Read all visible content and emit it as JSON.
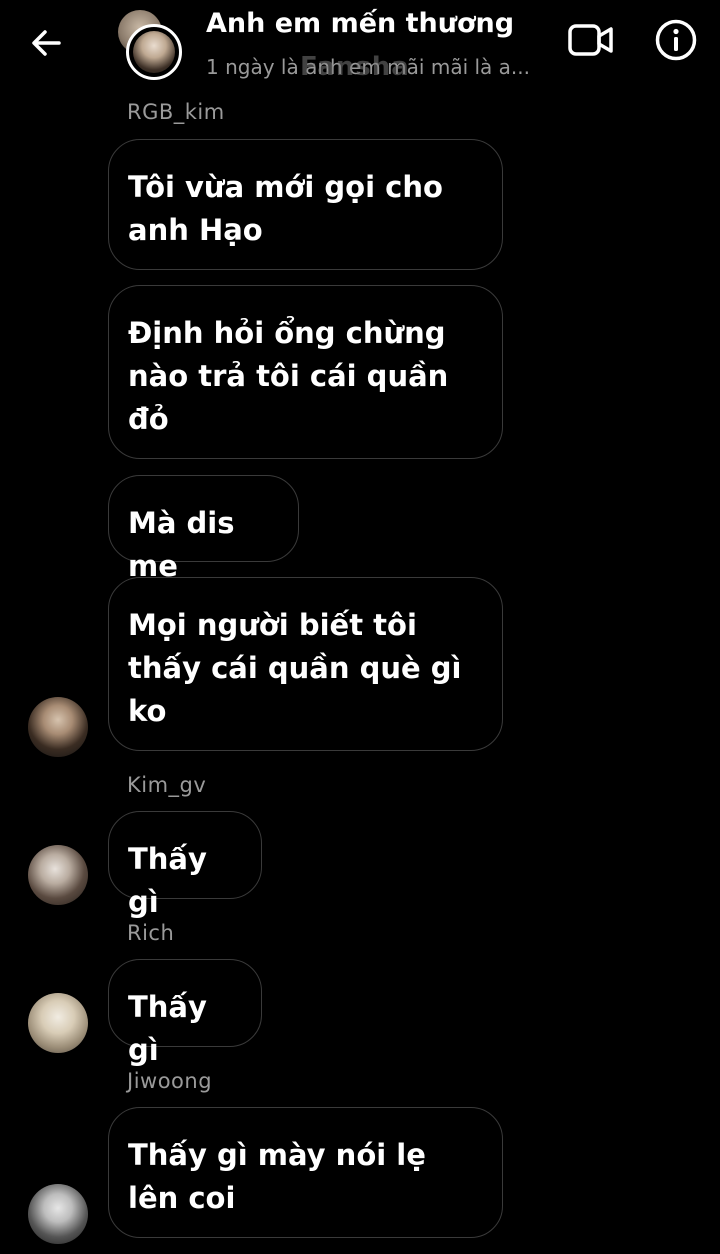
{
  "header": {
    "title": "Anh em mến thương",
    "subtitle": "1 ngày là anh em mãi mãi là a...",
    "watermark": "Fansha",
    "icons": {
      "back": "back-arrow-icon",
      "video": "video-call-icon",
      "info": "info-icon"
    }
  },
  "messages": [
    {
      "sender": "RGB_kim",
      "bubbles": [
        "Tôi vừa mới gọi cho anh Hạo",
        "Định hỏi ổng chừng nào trả tôi cái quần đỏ",
        "Mà dis me",
        "Mọi người biết tôi thấy cái quần què gì ko"
      ]
    },
    {
      "sender": "Kim_gv",
      "bubbles": [
        "Thấy gì"
      ]
    },
    {
      "sender": "Rich",
      "bubbles": [
        "Thấy gì"
      ]
    },
    {
      "sender": "Jiwoong",
      "bubbles": [
        "Thấy gì mày nói lẹ lên coi"
      ]
    }
  ],
  "colors": {
    "background": "#000000",
    "bubble_border": "#3a3a3a",
    "secondary_text": "#9a9a9a",
    "text": "#ffffff"
  }
}
